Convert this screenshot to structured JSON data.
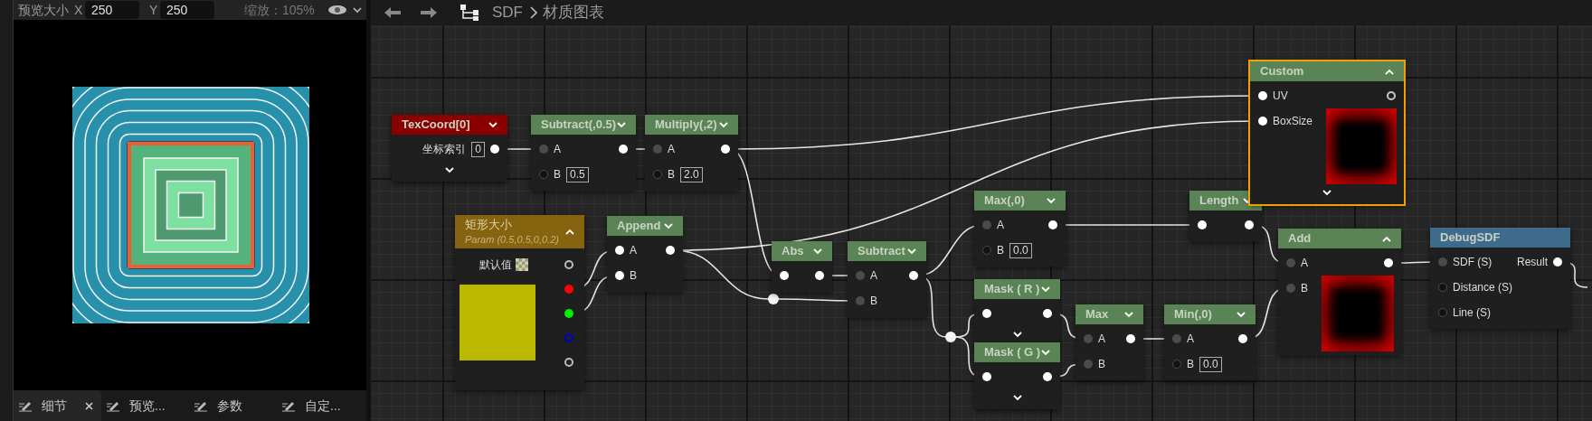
{
  "preview_panel": {
    "toolbar": {
      "size_label": "预览大小",
      "x_label": "X",
      "x_value": "250",
      "y_label": "Y",
      "y_value": "250",
      "zoom": "缩放：105%"
    },
    "tabs": [
      {
        "label": "细节",
        "selected": true,
        "closable": true
      },
      {
        "label": "预览...",
        "selected": false,
        "closable": false
      },
      {
        "label": "参数",
        "selected": false,
        "closable": false
      },
      {
        "label": "自定...",
        "selected": false,
        "closable": false
      }
    ]
  },
  "graph": {
    "breadcrumb": [
      "SDF",
      "材质图表"
    ],
    "nodes": [
      {
        "kind": "texcoord",
        "title": "TexCoord[0]",
        "expanded": false,
        "selected": false,
        "advanced": true,
        "rows": [
          {
            "label": "坐标索引",
            "value": "0",
            "out": {
              "kind": "filled"
            }
          }
        ]
      },
      {
        "kind": "math",
        "title": "Subtract(,0.5)",
        "expanded": false,
        "selected": false,
        "advanced": false,
        "rows": [
          {
            "in": {
              "kind": "grey"
            },
            "label": "A",
            "out": {
              "kind": "filled"
            }
          },
          {
            "in": {
              "kind": "hollow"
            },
            "label": "B",
            "value": "0.5"
          }
        ]
      },
      {
        "kind": "math",
        "title": "Multiply(,2)",
        "expanded": false,
        "selected": false,
        "advanced": false,
        "rows": [
          {
            "in": {
              "kind": "grey"
            },
            "label": "A",
            "out": {
              "kind": "filled"
            }
          },
          {
            "in": {
              "kind": "hollow"
            },
            "label": "B",
            "value": "2.0"
          }
        ]
      },
      {
        "kind": "param",
        "title": "矩形大小",
        "subtitle": "Param (0.5,0.5,0,0.2)",
        "expanded": true,
        "selected": false,
        "default_label": "默认值",
        "color": "#bbb800",
        "outputs": [
          {
            "color": "#bbbbbb",
            "connected": false
          },
          {
            "color": "#ff0000",
            "connected": true
          },
          {
            "color": "#00ee00",
            "connected": true
          },
          {
            "color": "#0000cc",
            "connected": false
          },
          {
            "color": "#bbbbbb",
            "connected": false
          }
        ]
      },
      {
        "kind": "math",
        "title": "Append",
        "expanded": false,
        "selected": false,
        "advanced": false,
        "rows": [
          {
            "in": {
              "kind": "filled"
            },
            "label": "A",
            "out": {
              "kind": "filled"
            }
          },
          {
            "in": {
              "kind": "filled"
            },
            "label": "B"
          }
        ]
      },
      {
        "kind": "math",
        "title": "Abs",
        "expanded": false,
        "selected": false,
        "advanced": false,
        "rows": [
          {
            "in": {
              "kind": "filled"
            },
            "out": {
              "kind": "filled"
            }
          }
        ]
      },
      {
        "kind": "math",
        "title": "Subtract",
        "expanded": false,
        "selected": false,
        "advanced": false,
        "rows": [
          {
            "in": {
              "kind": "grey"
            },
            "label": "A",
            "out": {
              "kind": "filled"
            }
          },
          {
            "in": {
              "kind": "grey"
            },
            "label": "B"
          }
        ]
      },
      {
        "kind": "math",
        "title": "Max(,0)",
        "expanded": false,
        "selected": false,
        "advanced": false,
        "rows": [
          {
            "in": {
              "kind": "grey"
            },
            "label": "A",
            "out": {
              "kind": "filled"
            }
          },
          {
            "in": {
              "kind": "hollow"
            },
            "label": "B",
            "value": "0.0"
          }
        ]
      },
      {
        "kind": "math",
        "title": "Mask ( R )",
        "expanded": false,
        "selected": false,
        "advanced": true,
        "rows": [
          {
            "in": {
              "kind": "filled"
            },
            "out": {
              "kind": "filled"
            }
          }
        ]
      },
      {
        "kind": "math",
        "title": "Mask ( G )",
        "expanded": false,
        "selected": false,
        "advanced": true,
        "rows": [
          {
            "in": {
              "kind": "filled"
            },
            "out": {
              "kind": "filled"
            }
          }
        ]
      },
      {
        "kind": "math",
        "title": "Max",
        "expanded": false,
        "selected": false,
        "advanced": false,
        "rows": [
          {
            "in": {
              "kind": "grey"
            },
            "label": "A",
            "out": {
              "kind": "filled"
            }
          },
          {
            "in": {
              "kind": "grey"
            },
            "label": "B"
          }
        ]
      },
      {
        "kind": "math",
        "title": "Min(,0)",
        "expanded": false,
        "selected": false,
        "advanced": false,
        "rows": [
          {
            "in": {
              "kind": "grey"
            },
            "label": "A",
            "out": {
              "kind": "filled"
            }
          },
          {
            "in": {
              "kind": "hollow"
            },
            "label": "B",
            "value": "0.0"
          }
        ]
      },
      {
        "kind": "math",
        "title": "Length",
        "expanded": false,
        "selected": false,
        "advanced": false,
        "rows": [
          {
            "in": {
              "kind": "filled"
            },
            "out": {
              "kind": "filled"
            }
          }
        ]
      },
      {
        "kind": "math",
        "title": "Custom",
        "expanded": true,
        "selected": true,
        "preview": true,
        "advanced": true,
        "rows": [
          {
            "in": {
              "kind": "filled"
            },
            "label": "UV",
            "out": {
              "kind": "ring"
            }
          },
          {
            "in": {
              "kind": "filled"
            },
            "label": "BoxSize"
          }
        ]
      },
      {
        "kind": "math",
        "title": "Add",
        "expanded": true,
        "selected": false,
        "preview": true,
        "advanced": false,
        "rows": [
          {
            "in": {
              "kind": "grey"
            },
            "label": "A",
            "out": {
              "kind": "filled"
            }
          },
          {
            "in": {
              "kind": "grey"
            },
            "label": "B"
          }
        ]
      },
      {
        "kind": "function",
        "title": "DebugSDF",
        "selected": false,
        "advanced": false,
        "rows": [
          {
            "in": {
              "kind": "grey"
            },
            "label": "SDF (S)",
            "out_label": "Result",
            "out": {
              "kind": "filled"
            }
          },
          {
            "in": {
              "kind": "hollow"
            },
            "label": "Distance (S)"
          },
          {
            "in": {
              "kind": "hollow"
            },
            "label": "Line (S)"
          }
        ]
      }
    ]
  }
}
